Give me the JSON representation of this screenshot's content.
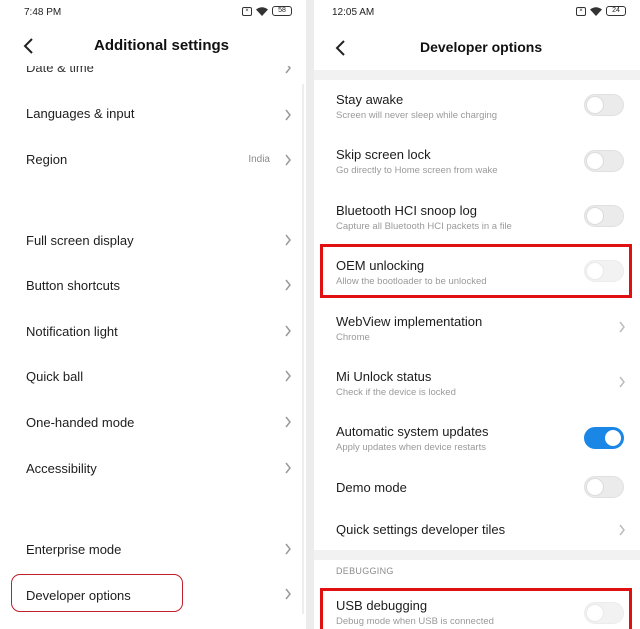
{
  "left": {
    "status": {
      "time": "7:48 PM",
      "battery": "58"
    },
    "title": "Additional settings",
    "cut_item": "Date & time",
    "items": [
      {
        "label": "Languages & input",
        "value": ""
      },
      {
        "label": "Region",
        "value": "India"
      },
      {
        "label": "Full screen display",
        "value": ""
      },
      {
        "label": "Button shortcuts",
        "value": ""
      },
      {
        "label": "Notification light",
        "value": ""
      },
      {
        "label": "Quick ball",
        "value": ""
      },
      {
        "label": "One-handed mode",
        "value": ""
      },
      {
        "label": "Accessibility",
        "value": ""
      },
      {
        "label": "Enterprise mode",
        "value": ""
      },
      {
        "label": "Developer options",
        "value": ""
      }
    ]
  },
  "right": {
    "status": {
      "time": "12:05 AM",
      "battery": "24"
    },
    "title": "Developer options",
    "items": [
      {
        "title": "Stay awake",
        "subtitle": "Screen will never sleep while charging",
        "control": "toggle",
        "on": false
      },
      {
        "title": "Skip screen lock",
        "subtitle": "Go directly to Home screen from wake",
        "control": "toggle",
        "on": false
      },
      {
        "title": "Bluetooth HCI snoop log",
        "subtitle": "Capture all Bluetooth HCI packets in a file",
        "control": "toggle",
        "on": false
      },
      {
        "title": "OEM unlocking",
        "subtitle": "Allow the bootloader to be unlocked",
        "control": "toggle",
        "on": false
      },
      {
        "title": "WebView implementation",
        "subtitle": "Chrome",
        "control": "chevron"
      },
      {
        "title": "Mi Unlock status",
        "subtitle": "Check if the device is locked",
        "control": "chevron"
      },
      {
        "title": "Automatic system updates",
        "subtitle": "Apply updates when device restarts",
        "control": "toggle",
        "on": true
      },
      {
        "title": "Demo mode",
        "subtitle": "",
        "control": "toggle",
        "on": false
      },
      {
        "title": "Quick settings developer tiles",
        "subtitle": "",
        "control": "chevron"
      }
    ],
    "section": "DEBUGGING",
    "debug_items": [
      {
        "title": "USB debugging",
        "subtitle": "Debug mode when USB is connected",
        "control": "toggle",
        "on": false
      }
    ]
  },
  "colors": {
    "accent": "#1a87e6",
    "highlight": "#e01010"
  }
}
